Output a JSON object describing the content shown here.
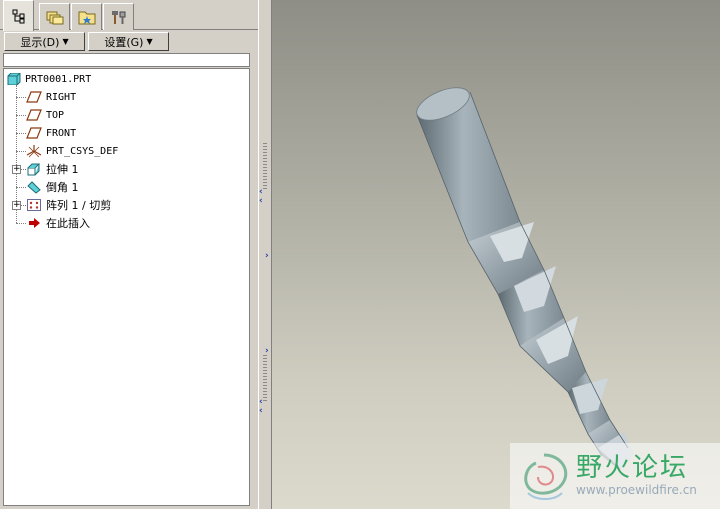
{
  "navigator": {
    "tabs": [
      {
        "name": "model-tree",
        "icon": "model-tree-icon",
        "active": true
      },
      {
        "name": "folder-browser",
        "icon": "layers-folder-icon",
        "active": false
      },
      {
        "name": "favorites",
        "icon": "favorites-folder-icon",
        "active": false
      },
      {
        "name": "connections",
        "icon": "tools-icon",
        "active": false
      }
    ],
    "show_menu_label": "显示(D)",
    "settings_menu_label": "设置(G)",
    "filter_value": ""
  },
  "tree": {
    "root": {
      "label": "PRT0001.PRT",
      "icon": "part-icon"
    },
    "items": [
      {
        "label": "RIGHT",
        "icon": "datum-plane-icon",
        "expandable": false
      },
      {
        "label": "TOP",
        "icon": "datum-plane-icon",
        "expandable": false
      },
      {
        "label": "FRONT",
        "icon": "datum-plane-icon",
        "expandable": false
      },
      {
        "label": "PRT_CSYS_DEF",
        "icon": "coordinate-system-icon",
        "expandable": false
      },
      {
        "label": "拉伸 1",
        "icon": "extrude-icon",
        "expandable": true
      },
      {
        "label": "倒角 1",
        "icon": "chamfer-icon",
        "expandable": false
      },
      {
        "label": "阵列 1 / 切剪",
        "icon": "pattern-icon",
        "expandable": true
      },
      {
        "label": "在此插入",
        "icon": "insert-here-arrow-icon",
        "expandable": false
      }
    ]
  },
  "colors": {
    "accent_blue": "#1f3ca8",
    "insert_arrow": "#c00000",
    "model_steel": "#9aa7ae"
  }
}
